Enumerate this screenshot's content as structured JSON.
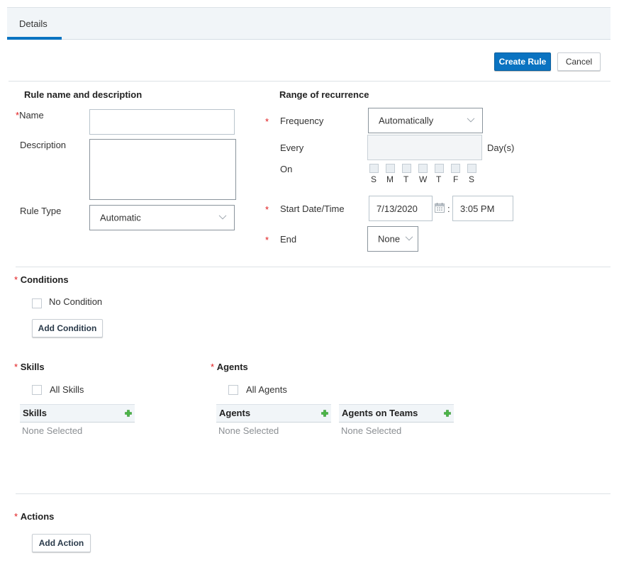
{
  "tabs": [
    {
      "label": "Details",
      "active": true
    }
  ],
  "toolbar": {
    "create_label": "Create Rule",
    "cancel_label": "Cancel"
  },
  "rule_section": {
    "heading": "Rule name and description",
    "name_label": "Name",
    "name_value": "",
    "description_label": "Description",
    "description_value": "",
    "rule_type_label": "Rule Type",
    "rule_type_value": "Automatic"
  },
  "recurrence": {
    "heading": "Range of recurrence",
    "frequency_label": "Frequency",
    "frequency_value": "Automatically",
    "every_label": "Every",
    "every_value": "",
    "every_unit": "Day(s)",
    "on_label": "On",
    "days": [
      "S",
      "M",
      "T",
      "W",
      "T",
      "F",
      "S"
    ],
    "start_label": "Start Date/Time",
    "start_date": "7/13/2020",
    "time_separator": ":",
    "start_time": "3:05 PM",
    "end_label": "End",
    "end_value": "None"
  },
  "conditions": {
    "heading": "Conditions",
    "no_condition_label": "No Condition",
    "add_label": "Add Condition"
  },
  "skills": {
    "heading": "Skills",
    "all_label": "All Skills",
    "list_header": "Skills",
    "empty_text": "None Selected"
  },
  "agents": {
    "heading": "Agents",
    "all_label": "All Agents",
    "agents_header": "Agents",
    "agents_empty": "None Selected",
    "teams_header": "Agents on Teams",
    "teams_empty": "None Selected"
  },
  "actions": {
    "heading": "Actions",
    "add_label": "Add Action"
  },
  "required_marker": "*",
  "colors": {
    "primary": "#0a73c1",
    "required": "#e0191b",
    "plus": "#5cb85c"
  }
}
